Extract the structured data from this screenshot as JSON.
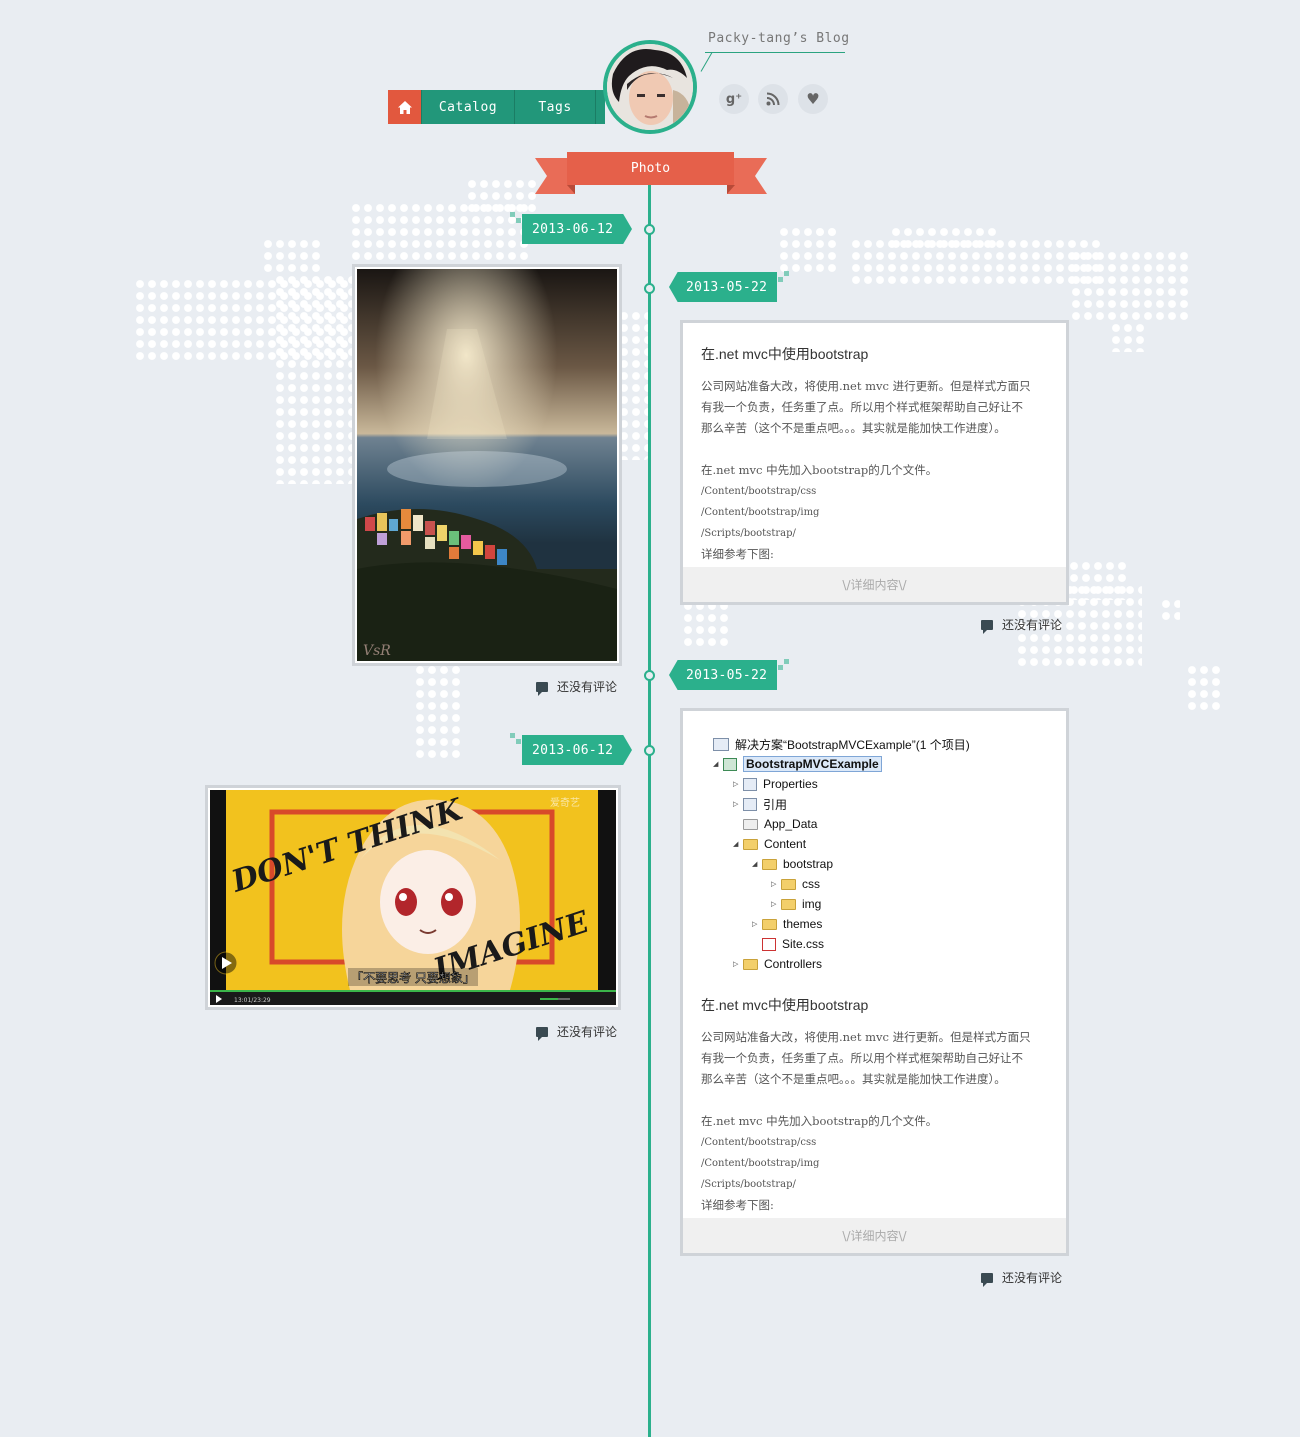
{
  "header": {
    "blog_title": "Packy-tang’s Blog",
    "nav": {
      "home_icon": "home-icon",
      "items": [
        {
          "label": "Catalog"
        },
        {
          "label": "Tags"
        }
      ]
    },
    "social": [
      {
        "name": "google-plus-icon",
        "glyph": "g⁺"
      },
      {
        "name": "rss-icon",
        "glyph": "◉"
      },
      {
        "name": "heart-icon",
        "glyph": "♥"
      }
    ],
    "ribbon": "Photo"
  },
  "colors": {
    "accent_green": "#2bb08c",
    "nav_green": "#22977a",
    "accent_red": "#e5604a",
    "background": "#e9edf2"
  },
  "timeline": {
    "dates": [
      "2013-06-12",
      "2013-05-22",
      "2013-05-22",
      "2013-06-12"
    ],
    "no_comment": "还没有评论"
  },
  "post1": {
    "title": "在.net mvc中使用bootstrap",
    "para1": [
      "公司网站准备大改，将使用.net mvc 进行更新。但是样式方面只",
      "有我一个负责，任务重了点。所以用个样式框架帮助自己好让不",
      "那么辛苦（这个不是重点吧。。。其实就是能加快工作进度）。"
    ],
    "para2": "在.net mvc 中先加入bootstrap的几个文件。",
    "paths": [
      "/Content/bootstrap/css",
      "/Content/bootstrap/img",
      "/Scripts/bootstrap/"
    ],
    "ref": "详细参考下图:",
    "more": "\\/详细内容\\/"
  },
  "post2": {
    "solution": {
      "root": "解决方案“BootstrapMVCExample”(1 个项目)",
      "project": "BootstrapMVCExample",
      "items": [
        "Properties",
        "引用",
        "App_Data",
        "Content",
        "bootstrap",
        "css",
        "img",
        "themes",
        "Site.css",
        "Controllers"
      ]
    },
    "title": "在.net mvc中使用bootstrap",
    "para1": [
      "公司网站准备大改，将使用.net mvc 进行更新。但是样式方面只",
      "有我一个负责，任务重了点。所以用个样式框架帮助自己好让不",
      "那么辛苦（这个不是重点吧。。。其实就是能加快工作进度）。"
    ],
    "para2": "在.net mvc 中先加入bootstrap的几个文件。",
    "paths": [
      "/Content/bootstrap/css",
      "/Content/bootstrap/img",
      "/Scripts/bootstrap/"
    ],
    "ref": "详细参考下图:",
    "more": "\\/详细内容\\/"
  },
  "video": {
    "caption": "「不要思考 只要想象」",
    "art_text_1": "DON'T THINK",
    "art_text_2": "IMAGINE",
    "watermark": "爱奇艺",
    "time": "13:01/23:29"
  }
}
